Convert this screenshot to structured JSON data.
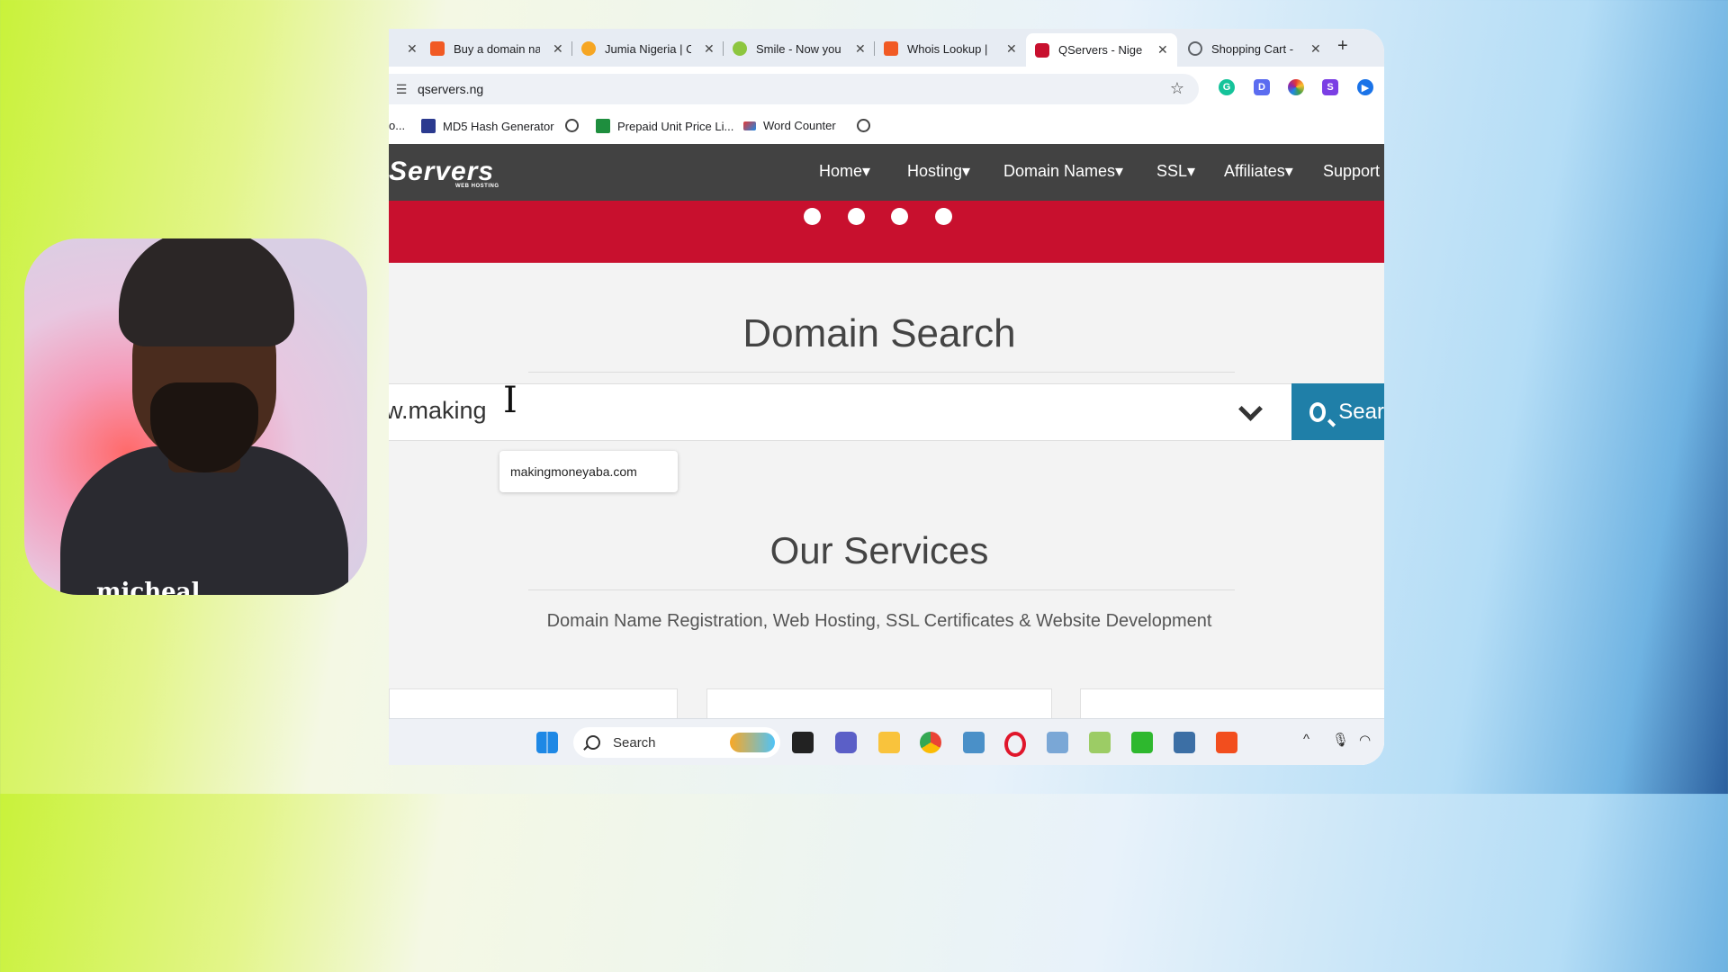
{
  "webcam": {
    "caption": "micheal"
  },
  "browser": {
    "tabs": [
      {
        "title": "Buy a domain na",
        "icon_color": "#f15a24",
        "active": false
      },
      {
        "title": "Jumia Nigeria | C",
        "icon_color": "#f6a623",
        "active": false
      },
      {
        "title": "Smile - Now you",
        "icon_color": "#8dc63f",
        "active": false
      },
      {
        "title": "Whois Lookup |",
        "icon_color": "#f15a24",
        "active": false
      },
      {
        "title": "QServers - Nige",
        "icon_color": "#c8102e",
        "active": true
      },
      {
        "title": "Shopping Cart -",
        "icon_color": "#5f6368",
        "active": false
      }
    ],
    "close_glyph": "✕",
    "new_tab": "+",
    "address": "qservers.ng",
    "extensions": [
      {
        "name": "grammarly-icon",
        "letter": "G",
        "color": "#15c39a"
      },
      {
        "name": "extension-d-icon",
        "letter": "D",
        "color": "#5b6cf0"
      },
      {
        "name": "color-picker-icon",
        "letter": "",
        "color": "#e53935"
      },
      {
        "name": "extension-s-icon",
        "letter": "S",
        "color": "#7b3fe4"
      },
      {
        "name": "extension-play-icon",
        "letter": "▶",
        "color": "#1a73e8"
      }
    ],
    "bookmarks": [
      {
        "label": "o..."
      },
      {
        "label": "MD5 Hash Generator"
      },
      {
        "label": ""
      },
      {
        "label": "Prepaid Unit Price Li..."
      },
      {
        "label": "Word Counter"
      },
      {
        "label": ""
      }
    ]
  },
  "site": {
    "logo": "Servers",
    "logo_sub": "WEB HOSTING",
    "nav": [
      "Home",
      "Hosting",
      "Domain Names",
      "SSL",
      "Affiliates",
      "Support"
    ],
    "caret": "▾",
    "domain_search_title": "Domain Search",
    "search_value": "w.making",
    "search_button": "Sear",
    "suggestion": "makingmoneyaba.com",
    "services_title": "Our Services",
    "services_sub": "Domain Name Registration, Web Hosting, SSL Certificates & Website Development",
    "accent": "#c8102e",
    "nav_bg": "#424242",
    "button_color": "#1f7fa8"
  },
  "taskbar": {
    "search_label": "Search"
  }
}
